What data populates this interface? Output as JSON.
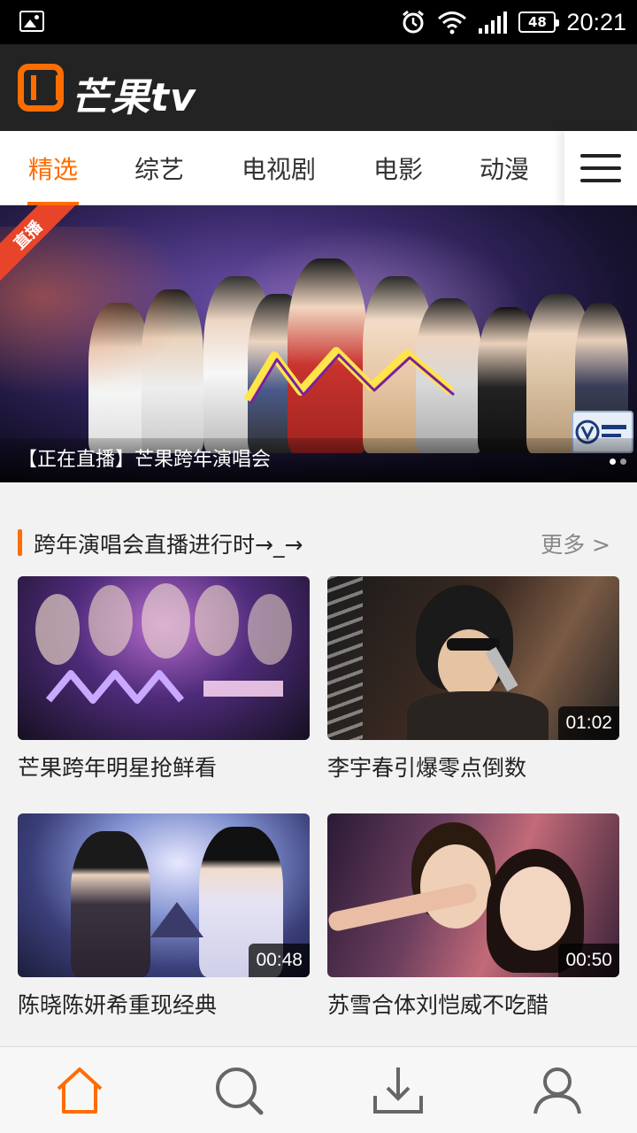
{
  "status_bar": {
    "time": "20:21",
    "battery": "48"
  },
  "app": {
    "logo_text": "芒果tv"
  },
  "tabs": [
    {
      "label": "精选",
      "active": true
    },
    {
      "label": "综艺",
      "active": false
    },
    {
      "label": "电视剧",
      "active": false
    },
    {
      "label": "电影",
      "active": false
    },
    {
      "label": "动漫",
      "active": false
    }
  ],
  "banner": {
    "badge": "直播",
    "caption": "【正在直播】芒果跨年演唱会",
    "page_index": 0,
    "page_count": 2
  },
  "section": {
    "title": "跨年演唱会直播进行时→_→",
    "more": "更多 >"
  },
  "cards": [
    {
      "title": "芒果跨年明星抢鲜看",
      "duration": ""
    },
    {
      "title": "李宇春引爆零点倒数",
      "duration": "01:02"
    },
    {
      "title": "陈晓陈妍希重现经典",
      "duration": "00:48"
    },
    {
      "title": "苏雪合体刘恺威不吃醋",
      "duration": "00:50"
    }
  ],
  "bottom_nav": [
    {
      "icon": "home-icon",
      "active": true
    },
    {
      "icon": "search-icon",
      "active": false
    },
    {
      "icon": "download-icon",
      "active": false
    },
    {
      "icon": "profile-icon",
      "active": false
    }
  ],
  "colors": {
    "accent": "#ff6d00",
    "topbar": "#232323",
    "text": "#222222"
  }
}
